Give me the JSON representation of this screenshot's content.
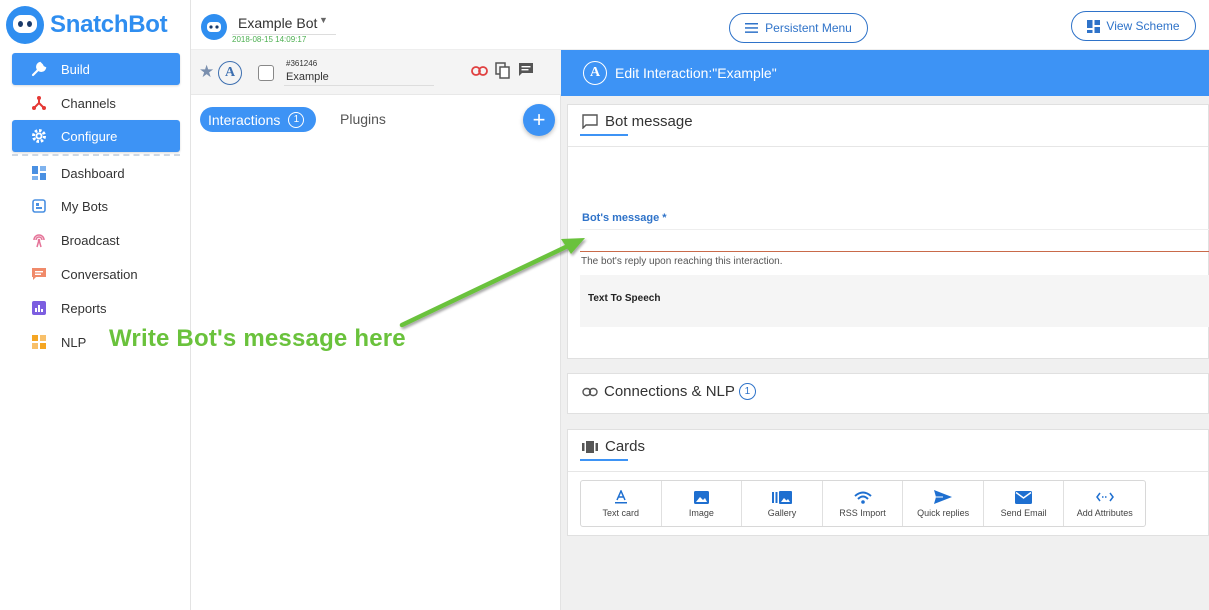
{
  "brand": {
    "name": "SnatchBot"
  },
  "sidebar": {
    "items": [
      {
        "label": "Build",
        "icon": "wrench-icon"
      },
      {
        "label": "Channels",
        "icon": "channels-icon"
      },
      {
        "label": "Configure",
        "icon": "gear-icon"
      },
      {
        "label": "Dashboard",
        "icon": "dashboard-icon"
      },
      {
        "label": "My Bots",
        "icon": "bots-icon"
      },
      {
        "label": "Broadcast",
        "icon": "broadcast-icon"
      },
      {
        "label": "Conversation",
        "icon": "conversation-icon"
      },
      {
        "label": "Reports",
        "icon": "reports-icon"
      },
      {
        "label": "NLP",
        "icon": "nlp-icon"
      }
    ],
    "accent": "#3d93f5"
  },
  "topbar": {
    "bot_name": "Example Bot",
    "bot_date": "2018-08-15 14:09:17",
    "persistent_menu_label": "Persistent Menu",
    "view_scheme_label": "View Scheme"
  },
  "interaction": {
    "id": "#361246",
    "name": "Example"
  },
  "middle": {
    "tab_interactions": "Interactions",
    "interactions_count": "1",
    "tab_plugins": "Plugins",
    "add_symbol": "+"
  },
  "editor": {
    "header_title": "Edit Interaction:\"Example\"",
    "header_icon_letter": "A",
    "bot_message_title": "Bot message",
    "bot_message_label": "Bot's message *",
    "bot_message_value": "",
    "bot_message_hint": "The bot's reply upon reaching this interaction.",
    "tts_label": "Text To Speech",
    "connections_title": "Connections & NLP",
    "connections_count": "1",
    "cards_title": "Cards",
    "tools": [
      {
        "label": "Text card",
        "icon": "text-card-icon"
      },
      {
        "label": "Image",
        "icon": "image-icon"
      },
      {
        "label": "Gallery",
        "icon": "gallery-icon"
      },
      {
        "label": "RSS Import",
        "icon": "rss-icon"
      },
      {
        "label": "Quick replies",
        "icon": "send-icon"
      },
      {
        "label": "Send Email",
        "icon": "email-icon"
      },
      {
        "label": "Add Attributes",
        "icon": "attributes-icon"
      }
    ]
  },
  "annotation": {
    "text": "Write Bot's message here",
    "color": "#6ac23c"
  }
}
